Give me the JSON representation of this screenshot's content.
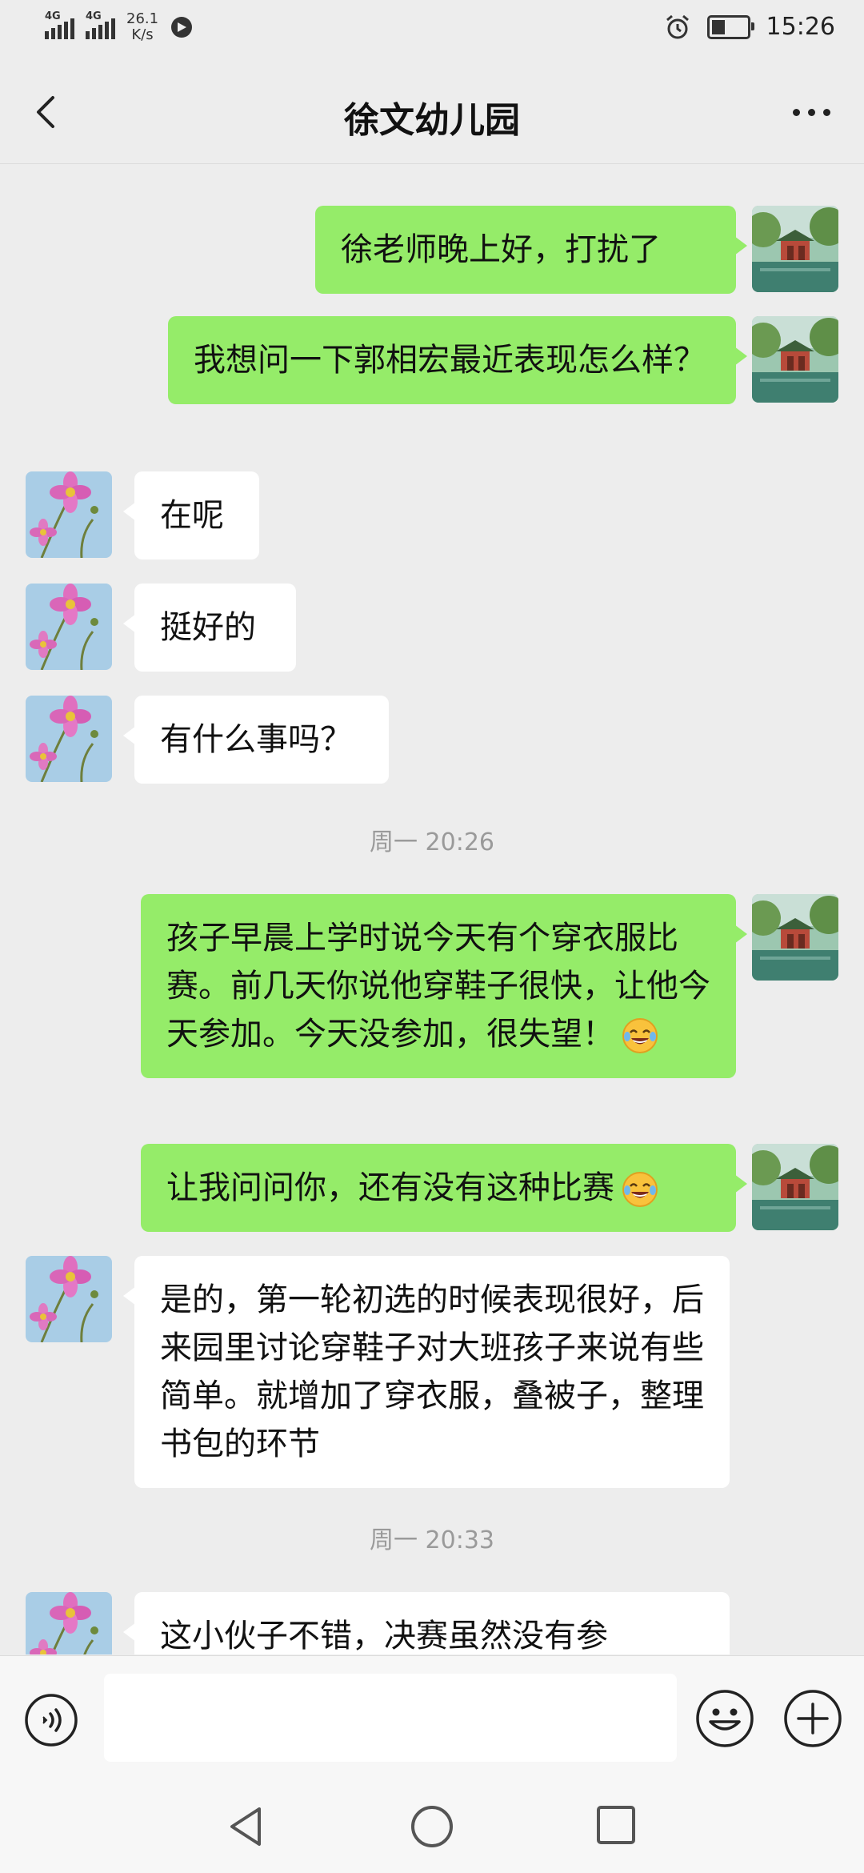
{
  "status_bar": {
    "net1": "4G",
    "net2": "4G",
    "speed_value": "26.1",
    "speed_unit": "K/s",
    "time": "15:26",
    "battery_level": 0.45
  },
  "header": {
    "title": "徐文幼儿园"
  },
  "messages": [
    {
      "from": "me",
      "text": "徐老师晚上好，打扰了"
    },
    {
      "from": "me",
      "text": "我想问一下郭相宏最近表现怎么样？"
    },
    {
      "from": "other",
      "text": "在呢"
    },
    {
      "from": "other",
      "text": "挺好的"
    },
    {
      "from": "other",
      "text": "有什么事吗？"
    },
    {
      "type": "time",
      "text": "周一 20:26"
    },
    {
      "from": "me",
      "text": "孩子早晨上学时说今天有个穿衣服比赛。前几天你说他穿鞋子很快，让他今天参加。今天没参加，很失望！",
      "emoji": "crying-laughing-emoji"
    },
    {
      "from": "me",
      "text": "让我问问你，还有没有这种比赛",
      "emoji": "crying-laughing-emoji"
    },
    {
      "from": "other",
      "text": "是的，第一轮初选的时候表现很好，后来园里讨论穿鞋子对大班孩子来说有些简单。就增加了穿衣服，叠被子，整理书包的环节"
    },
    {
      "type": "time",
      "text": "周一 20:33"
    },
    {
      "from": "other",
      "text": "这小伙子不错，决赛虽然没有参"
    }
  ],
  "input": {
    "placeholder": ""
  },
  "icons": {
    "back": "chevron-left-icon",
    "more": "more-dots-icon",
    "voice": "voice-icon",
    "emoji": "smiley-icon",
    "plus": "plus-icon",
    "nav_back": "triangle-back-icon",
    "nav_home": "circle-home-icon",
    "nav_recent": "square-recent-icon"
  },
  "colors": {
    "my_bubble": "#95ec69",
    "their_bubble": "#ffffff",
    "background": "#ededed"
  }
}
